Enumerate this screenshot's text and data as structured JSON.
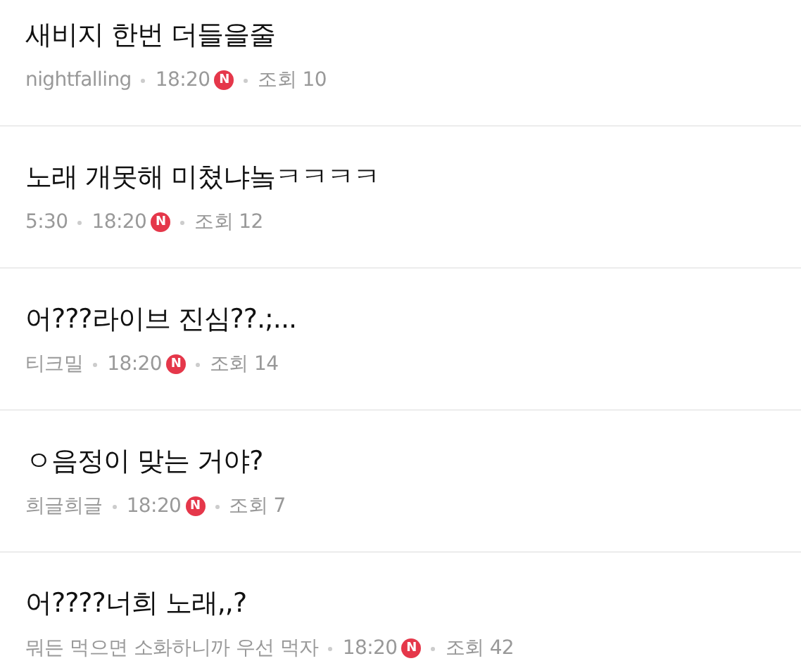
{
  "posts": [
    {
      "title": "새비지 한번 더들을줄",
      "author": "nightfalling",
      "time": "18:20",
      "badge": "N",
      "views": "조회 10"
    },
    {
      "title": "노래 개못해 미쳤냐놐ㅋㅋㅋㅋ",
      "author": "5:30",
      "time": "18:20",
      "badge": "N",
      "views": "조회 12"
    },
    {
      "title": "어???라이브 진심??.;...",
      "author": "티크밀",
      "time": "18:20",
      "badge": "N",
      "views": "조회 14"
    },
    {
      "title": "ㅇ음정이 맞는 거야?",
      "author": "희글희글",
      "time": "18:20",
      "badge": "N",
      "views": "조회 7"
    },
    {
      "title": "어????너희 노래,,?",
      "author": "뭐든 먹으면 소화하니까 우선 먹자",
      "time": "18:20",
      "badge": "N",
      "views": "조회 42"
    }
  ]
}
